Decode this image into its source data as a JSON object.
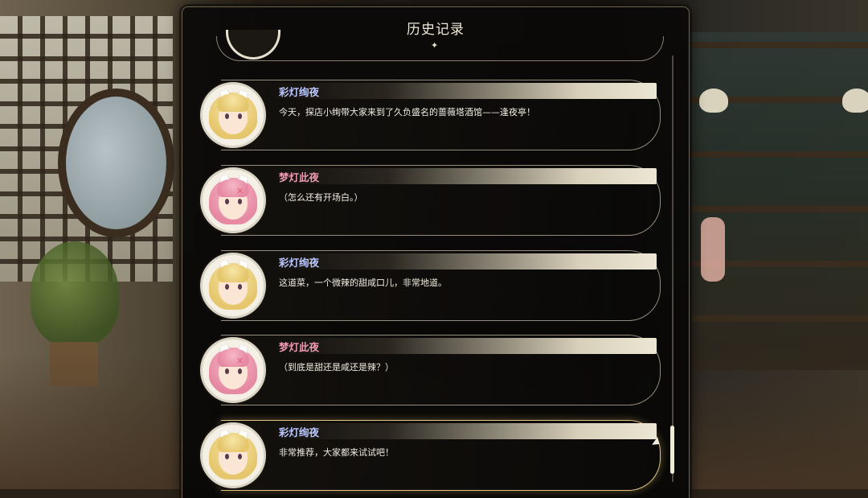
{
  "panel": {
    "title": "历史记录",
    "star_glyph": "✦"
  },
  "entries": [
    {
      "speaker": "彩灯绚夜",
      "speaker_color": "#b9c6ff",
      "avatar": "blonde-girl-avatar",
      "text": "今天，探店小绚带大家来到了久负盛名的蔷薇塔酒馆——逢夜亭！",
      "active": false
    },
    {
      "speaker": "梦灯此夜",
      "speaker_color": "#f19ab5",
      "avatar": "pink-hair-girl-avatar",
      "text": "（怎么还有开场白。）",
      "active": false
    },
    {
      "speaker": "彩灯绚夜",
      "speaker_color": "#b9c6ff",
      "avatar": "blonde-girl-avatar",
      "text": "这道菜，一个微辣的甜咸口儿，非常地道。",
      "active": false
    },
    {
      "speaker": "梦灯此夜",
      "speaker_color": "#f19ab5",
      "avatar": "pink-hair-girl-avatar",
      "text": "（到底是甜还是咸还是辣？）",
      "active": false
    },
    {
      "speaker": "彩灯绚夜",
      "speaker_color": "#b9c6ff",
      "avatar": "blonde-girl-avatar",
      "text": "非常推荐，大家都来试试吧！",
      "active": true
    }
  ]
}
